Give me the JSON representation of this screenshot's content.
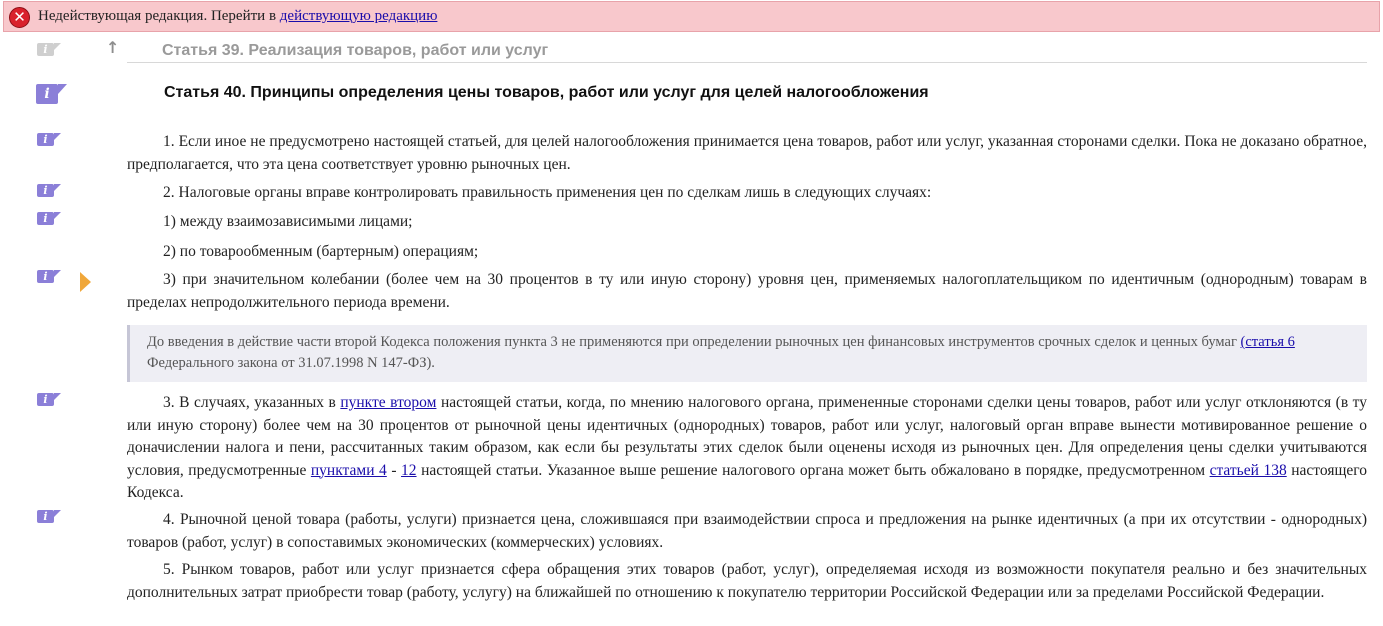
{
  "banner": {
    "text": "Недействующая редакция. Перейти в ",
    "link": "действующую редакцию"
  },
  "icons": {
    "info": "i",
    "up_arrow": "↑"
  },
  "previous_article": "Статья 39. Реализация товаров, работ или услуг",
  "article_title": "Статья 40. Принципы определения цены товаров, работ или услуг для целей налогообложения",
  "paragraphs": {
    "p1": "1. Если иное не предусмотрено настоящей статьей, для целей налогообложения принимается цена товаров, работ или услуг, указанная сторонами сделки. Пока не доказано обратное, предполагается, что эта цена соответствует уровню рыночных цен.",
    "p2": "2. Налоговые органы вправе контролировать правильность применения цен по сделкам лишь в следующих случаях:",
    "p2_1": "1) между взаимозависимыми лицами;",
    "p2_2": "2) по товарообменным (бартерным) операциям;",
    "p2_3": "3) при значительном колебании (более чем на 30 процентов в ту или иную сторону) уровня цен, применяемых налогоплательщиком по идентичным (однородным) товарам в пределах непродолжительного периода времени.",
    "p4": "4. Рыночной ценой товара (работы, услуги) признается цена, сложившаяся при взаимодействии спроса и предложения на рынке идентичных (а при их отсутствии - однородных) товаров (работ, услуг) в сопоставимых экономических (коммерческих) условиях.",
    "p5": "5. Рынком товаров, работ или услуг признается сфера обращения этих товаров (работ, услуг), определяемая исходя из возможности покупателя реально и без значительных дополнительных затрат приобрести товар (работу, услугу) на ближайшей по отношению к покупателю территории Российской Федерации или за пределами Российской Федерации."
  },
  "note": {
    "text_before": "До введения в действие части второй Кодекса положения пункта 3 не применяются при определении рыночных цен финансовых инструментов срочных сделок и ценных бумаг ",
    "link_open": "(",
    "link": "статья 6",
    "text_after": " Федерального закона от 31.07.1998 N 147-ФЗ)."
  },
  "p3": {
    "t1": "3. В случаях, указанных в ",
    "link1": "пункте втором",
    "t2": " настоящей статьи, когда, по мнению налогового органа, примененные сторонами сделки цены товаров, работ или услуг отклоняются (в ту или иную сторону) более чем на 30 процентов от рыночной цены идентичных (однородных) товаров, работ или услуг, налоговый орган вправе вынести мотивированное решение о доначислении налога и пени, рассчитанных таким образом, как если бы результаты этих сделок были оценены исходя из рыночных цен. Для определения цены сделки учитываются условия, предусмотренные ",
    "link2": "пунктами 4",
    "t3": " - ",
    "link3": "12",
    "t4": " настоящей статьи. Указанное выше решение налогового органа может быть обжаловано в порядке, предусмотренном ",
    "link4": "статьей 138",
    "t5": " настоящего Кодекса."
  }
}
